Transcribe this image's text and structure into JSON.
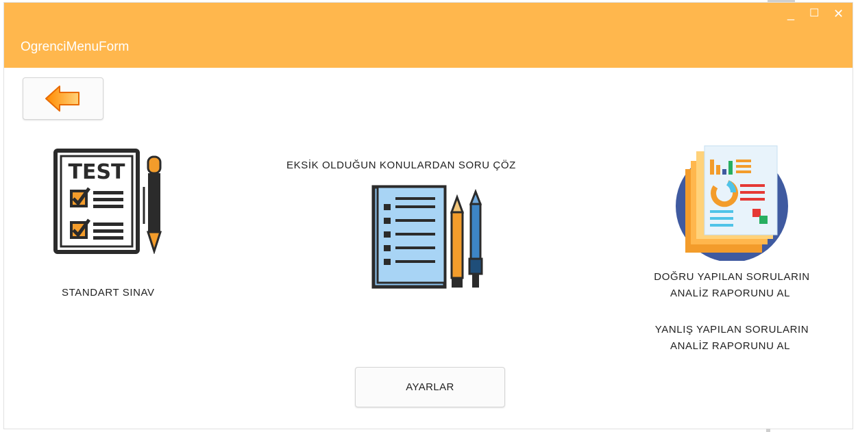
{
  "window": {
    "title": "OgrenciMenuForm"
  },
  "controls": {
    "minimize": "_",
    "maximize": "☐",
    "close": "✕"
  },
  "back_button": {
    "icon": "back-arrow-icon"
  },
  "standard_exam": {
    "label": "STANDART SINAV",
    "icon": "test-checklist-icon"
  },
  "weak_topics": {
    "label": "EKSİK OLDUĞUN KONULARDAN SORU ÇÖZ",
    "icon": "document-pencils-icon"
  },
  "report": {
    "icon": "analytics-report-icon",
    "correct_line1": "DOĞRU YAPILAN SORULARIN",
    "correct_line2": "ANALİZ RAPORUNU AL",
    "wrong_line1": "YANLIŞ YAPILAN SORULARIN",
    "wrong_line2": "ANALİZ RAPORUNU AL"
  },
  "settings_button": {
    "label": "AYARLAR"
  },
  "colors": {
    "accent": "#ffb74d",
    "icon_dark": "#2b2b2b",
    "icon_orange": "#f39c2b",
    "icon_blue": "#8ec5f2",
    "report_circle": "#3f5aa0"
  }
}
